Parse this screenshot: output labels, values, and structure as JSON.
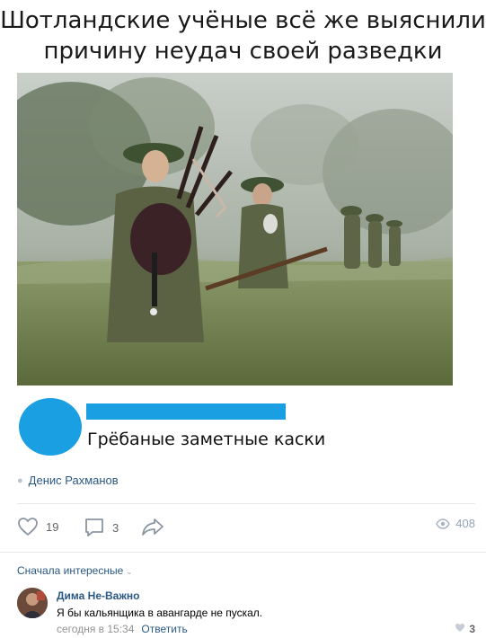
{
  "meme": {
    "title_line1": "Шотландские учёные всё же выяснили",
    "title_line2": "причину неудач своей разведки",
    "comment_text": "Грёбаные заметные каски"
  },
  "post": {
    "author": "Денис Рахманов",
    "likes": "19",
    "comments": "3",
    "views": "408"
  },
  "comments_section": {
    "sort_label": "Сначала интересные",
    "items": [
      {
        "name": "Дима Не-Важно",
        "text": "Я бы кальянщика в авангарде не пускал.",
        "time": "сегодня в 15:34",
        "reply_label": "Ответить",
        "likes": "3"
      }
    ]
  },
  "colors": {
    "link": "#2a5885",
    "meme_blue": "#1b9fe3"
  }
}
